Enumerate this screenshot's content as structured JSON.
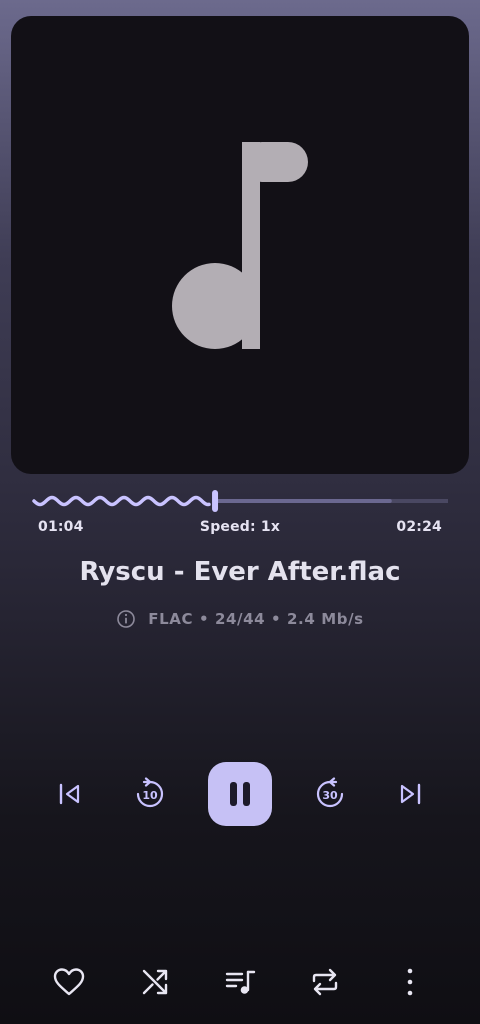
{
  "player": {
    "track_title": "Ryscu - Ever After.flac",
    "format_info": "FLAC • 24/44 • 2.4 Mb/s",
    "elapsed": "01:04",
    "total": "02:24",
    "speed_label": "Speed: 1x",
    "progress_fraction": 0.44,
    "buffered_fraction": 0.86,
    "playing": true,
    "rewind_seconds": "10",
    "forward_seconds": "30"
  },
  "colors": {
    "accent": "#c6c1f5",
    "seek_played": "#c9c3ff",
    "seek_buffered": "#6b6890",
    "seek_remaining": "#4a4862",
    "art_background": "#121016",
    "art_icon": "#b3aeb4"
  },
  "icons": {
    "album_art": "music-note-icon",
    "info": "info-icon",
    "previous": "skip-previous-icon",
    "rewind": "replay-10-icon",
    "pause": "pause-icon",
    "forward": "forward-30-icon",
    "next": "skip-next-icon",
    "favorite": "heart-icon",
    "shuffle": "shuffle-icon",
    "queue": "queue-music-icon",
    "repeat": "repeat-icon",
    "more": "more-vertical-icon"
  }
}
